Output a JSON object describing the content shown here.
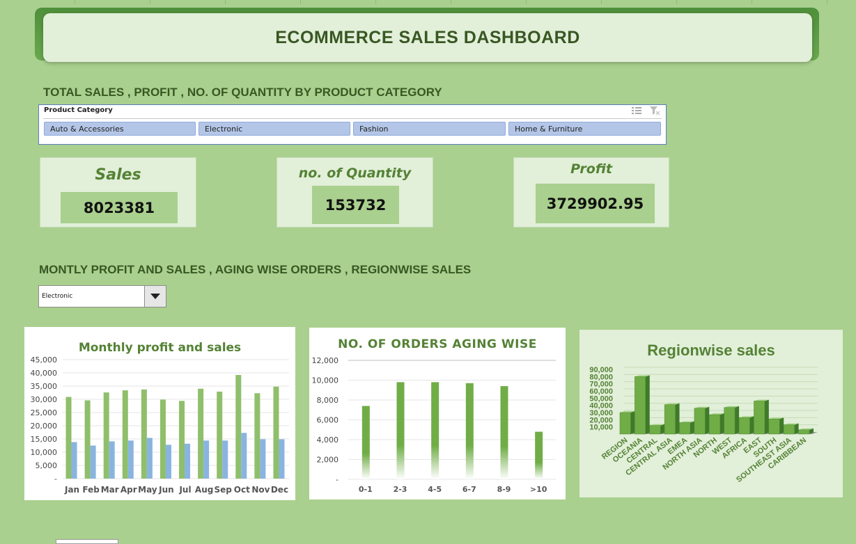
{
  "dashboard": {
    "title": "ECOMMERCE SALES DASHBOARD"
  },
  "section1": {
    "heading": "TOTAL SALES , PROFIT , NO. OF QUANTITY BY PRODUCT CATEGORY"
  },
  "slicer": {
    "header": "Product Category",
    "items": [
      "Auto & Accessories",
      "Electronic",
      "Fashion",
      "Home & Furniture"
    ]
  },
  "kpis": {
    "sales": {
      "label": "Sales",
      "value": "8023381"
    },
    "quantity": {
      "label": "no. of Quantity",
      "value": "153732"
    },
    "profit": {
      "label": "Profit",
      "value": "3729902.95"
    }
  },
  "section2": {
    "heading": "MONTLY PROFIT AND SALES , AGING WISE ORDERS , REGIONWISE SALES"
  },
  "filter": {
    "selected": "Electronic"
  },
  "colors": {
    "background": "#a9d08e",
    "title_text": "#385723",
    "bar_green": "#8fbf6b",
    "bar_blue": "#8ab4e0",
    "aging_bar": "#70ad47"
  },
  "icons": [
    "multi-select-icon",
    "clear-filter-icon",
    "dropdown-arrow-icon"
  ],
  "chart_data": [
    {
      "type": "bar",
      "title": "Monthly profit and sales",
      "categories": [
        "Jan",
        "Feb",
        "Mar",
        "Apr",
        "May",
        "Jun",
        "Jul",
        "Aug",
        "Sep",
        "Oct",
        "Nov",
        "Dec"
      ],
      "series": [
        {
          "values": [
            30900,
            29600,
            32600,
            33400,
            33700,
            29900,
            29400,
            34000,
            32900,
            39200,
            32300,
            34800
          ]
        },
        {
          "values": [
            13800,
            12500,
            14100,
            14400,
            15400,
            12800,
            13200,
            14400,
            14400,
            17300,
            14900,
            14900
          ]
        }
      ],
      "ylim": [
        0,
        45000
      ],
      "yticks": [
        "-",
        "5,000",
        "10,000",
        "15,000",
        "20,000",
        "25,000",
        "30,000",
        "35,000",
        "40,000",
        "45,000"
      ],
      "grid": true
    },
    {
      "type": "bar",
      "title": "NO. OF ORDERS AGING WISE",
      "categories": [
        "0-1",
        "2-3",
        "4-5",
        "6-7",
        "8-9",
        ">10"
      ],
      "values": [
        7400,
        9800,
        9800,
        9700,
        9400,
        4800
      ],
      "ylim": [
        0,
        12000
      ],
      "yticks": [
        "-",
        "2,000",
        "4,000",
        "6,000",
        "8,000",
        "10,000",
        "12,000"
      ],
      "grid": true
    },
    {
      "type": "bar",
      "title": "Regionwise sales",
      "categories": [
        "REGION",
        "OCEANIA",
        "CENTRAL",
        "CENTRAL ASIA",
        "EMEA",
        "NORTH ASIA",
        "NORTH",
        "WEST",
        "AFRICA",
        "EAST",
        "SOUTH",
        "SOUTHEAST ASIA",
        "CARIBBEAN"
      ],
      "values": [
        30000,
        80000,
        12000,
        41000,
        16000,
        36000,
        27000,
        37000,
        23000,
        46000,
        21000,
        13000,
        6000
      ],
      "ylim": [
        0,
        90000
      ],
      "yticks": [
        "10,000",
        "20,000",
        "30,000",
        "40,000",
        "50,000",
        "60,000",
        "70,000",
        "80,000",
        "90,000"
      ],
      "grid": true
    }
  ]
}
